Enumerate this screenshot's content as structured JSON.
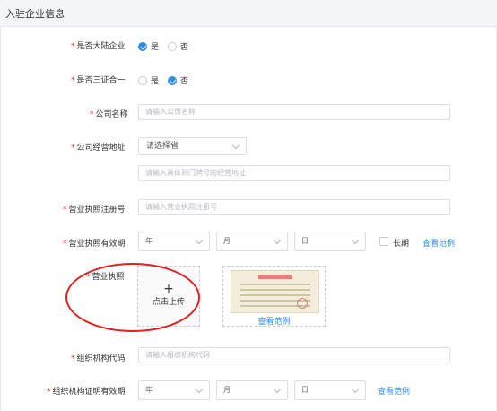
{
  "header": {
    "title": "入驻企业信息"
  },
  "form": {
    "mainland": {
      "label": "是否大陆企业",
      "options": [
        {
          "label": "是",
          "checked": true
        },
        {
          "label": "否",
          "checked": false
        }
      ]
    },
    "three_in_one": {
      "label": "是否三证合一",
      "options": [
        {
          "label": "是",
          "checked": false
        },
        {
          "label": "否",
          "checked": true
        }
      ]
    },
    "company_name": {
      "label": "公司名称",
      "placeholder": "请输入公司名称"
    },
    "business_address": {
      "label": "公司经营地址",
      "province_select": "请选择省",
      "detail_placeholder": "请输入具体到门牌号的经营地址"
    },
    "license_reg_no": {
      "label": "营业执照注册号",
      "placeholder": "请输入营业执照注册号"
    },
    "license_validity": {
      "label": "营业执照有效期",
      "year": "年",
      "month": "月",
      "day": "日",
      "long_term": "长期",
      "example_link": "查看范例"
    },
    "license": {
      "label": "营业执照",
      "upload_plus": "+",
      "upload_text": "点击上传",
      "sample_link": "查看范例"
    },
    "org_code": {
      "label": "组织机构代码",
      "placeholder": "请输入组织机构代码"
    },
    "org_validity": {
      "label": "组织机构证明有效期",
      "year": "年",
      "month": "月",
      "day": "日",
      "example_link": "查看范例"
    }
  },
  "required_mark": "*",
  "colors": {
    "accent": "#2d8cf0",
    "required": "#e5302f",
    "annotation": "#e02020"
  }
}
